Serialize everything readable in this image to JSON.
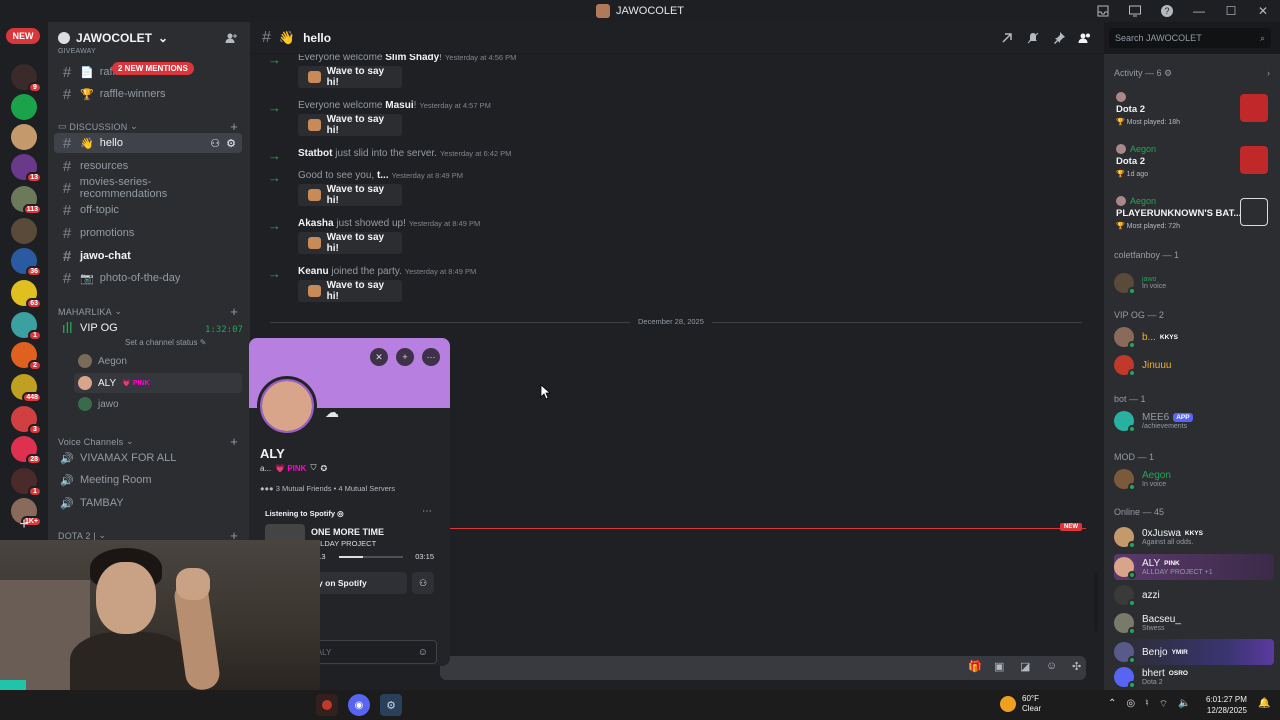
{
  "window": {
    "title": "JAWOCOLET"
  },
  "guilds": {
    "new_label": "NEW",
    "badges": [
      "9",
      "",
      "",
      "13",
      "113",
      "",
      "36",
      "63",
      "1",
      "2",
      "448",
      "3",
      "28",
      "1",
      "1K+"
    ]
  },
  "server": {
    "name": "JAWOCOLET",
    "mentions": "2 NEW MENTIONS",
    "channels_top": [
      {
        "name": "raffle",
        "icon": "📄"
      },
      {
        "name": "raffle-winners",
        "icon": "🏆"
      }
    ],
    "cut_category": "GIVEAWAY",
    "discussion_label": "DISCUSSION",
    "discussion_channels": [
      {
        "name": "hello",
        "icon": "👋",
        "active": true
      },
      {
        "name": "resources"
      },
      {
        "name": "movies-series-recommendations"
      },
      {
        "name": "off-topic"
      },
      {
        "name": "promotions"
      },
      {
        "name": "jawo-chat",
        "bold": true
      },
      {
        "name": "photo-of-the-day",
        "icon": "📷"
      }
    ],
    "maharlika_label": "MAHARLIKA",
    "vip_channel": "VIP OG",
    "vip_timer": "1:32:07",
    "vip_status": "Set a channel status",
    "vip_users": [
      {
        "name": "Aegon"
      },
      {
        "name": "ALY",
        "tag": "PINK"
      },
      {
        "name": "jawo"
      }
    ],
    "voice_label": "Voice Channels",
    "voice_channels": [
      "VIVAMAX FOR ALL",
      "Meeting Room",
      "TAMBAY"
    ],
    "dota_label": "DOTA 2 |"
  },
  "topbar": {
    "channel": "hello",
    "channel_icon": "👋",
    "search_placeholder": "Search JAWOCOLET"
  },
  "messages": [
    {
      "prefix": "Everyone welcome ",
      "name": "Slim Shady",
      "suffix": "!",
      "time": "Yesterday at 4:56 PM",
      "wave": "Wave to say hi!"
    },
    {
      "prefix": "Everyone welcome ",
      "name": "Masui",
      "suffix": "!",
      "time": "Yesterday at 4:57 PM",
      "wave": "Wave to say hi!"
    },
    {
      "prefix": "",
      "name": "Statbot",
      "suffix": " just slid into the server.",
      "time": "Yesterday at 6:42 PM",
      "wave": ""
    },
    {
      "prefix": "Good to see you, ",
      "name": "t...",
      "suffix": "",
      "time": "Yesterday at 8:49 PM",
      "wave": "Wave to say hi!"
    },
    {
      "prefix": "",
      "name": "Akasha",
      "suffix": " just showed up!",
      "time": "Yesterday at 8:49 PM",
      "wave": "Wave to say hi!"
    },
    {
      "prefix": "",
      "name": "Keanu",
      "suffix": " joined the party.",
      "time": "Yesterday at 8:49 PM",
      "wave": "Wave to say hi!"
    }
  ],
  "date_divider": "December 28, 2025",
  "new_marker": "NEW",
  "profile": {
    "name": "ALY",
    "subline": "a...",
    "tag": "PINK",
    "mutual_friends": "3 Mutual Friends",
    "mutual_servers": "4 Mutual Servers",
    "listening_label": "Listening to Spotify",
    "song": "ONE MORE TIME",
    "artist": "ALLDAY PROJECT",
    "elapsed": "1:13",
    "duration": "03:15",
    "progress": 0.37,
    "play_label": "Play on Spotify",
    "message_placeholder": "Message @ALY"
  },
  "activity": {
    "header": "Activity — 6",
    "items": [
      {
        "user": "",
        "game": "Dota 2",
        "sub": "Most played: 18h",
        "icon": "dota"
      },
      {
        "user": "Aegon",
        "game": "Dota 2",
        "sub": "1d ago",
        "icon": "dota"
      },
      {
        "user": "Aegon",
        "game": "PLAYERUNKNOWN'S BAT...",
        "sub": "Most played: 72h",
        "icon": "pubg"
      }
    ]
  },
  "member_sections": [
    {
      "label": "coletfanboy — 1",
      "members": [
        {
          "name": "",
          "status": "In voice",
          "extra": "jawo"
        }
      ]
    },
    {
      "label": "VIP OG — 2",
      "members": [
        {
          "name": "b...",
          "tag": "KKYS"
        },
        {
          "name": "Jinuuu"
        }
      ]
    },
    {
      "label": "bot — 1",
      "members": [
        {
          "name": "MEE6",
          "tag": "APP",
          "status": "/achievements"
        }
      ]
    },
    {
      "label": "MOD — 1",
      "members": [
        {
          "name": "Aegon",
          "status": "In voice"
        }
      ]
    },
    {
      "label": "Online — 45",
      "members": [
        {
          "name": "0xJuswa",
          "tag": "KKYS",
          "status": "Against all odds."
        },
        {
          "name": "ALY",
          "tag": "PINK",
          "status": "ALLDAY PROJECT +1"
        },
        {
          "name": "azzi",
          "status": ""
        },
        {
          "name": "Bacseu_",
          "status": "Stwess"
        },
        {
          "name": "Benjo",
          "tag": "YMIR",
          "status": ""
        },
        {
          "name": "bhert",
          "tag": "OSRO",
          "status": "Dota 2"
        }
      ]
    }
  ],
  "taskbar": {
    "temp": "60°F",
    "weather": "Clear",
    "time": "6:01:27 PM",
    "date": "12/28/2025"
  },
  "colors": {
    "accent": "#5865f2",
    "online": "#23a55a",
    "mention": "#da373c",
    "banner": "#b77fe0"
  }
}
